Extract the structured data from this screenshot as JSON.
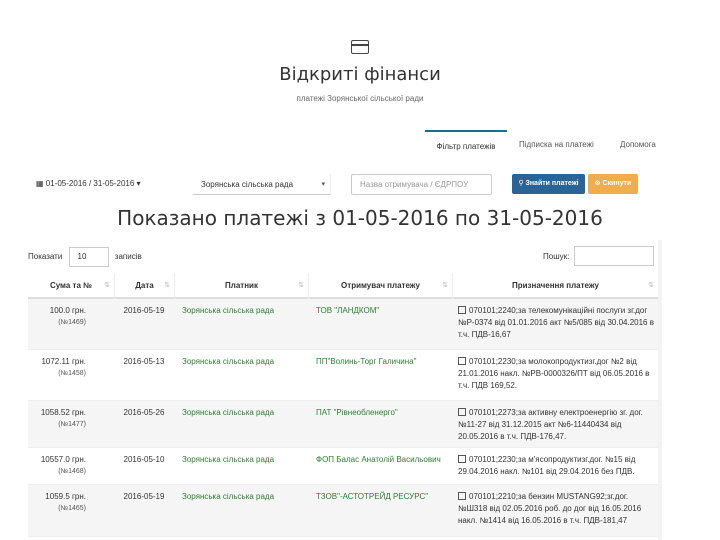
{
  "brand": {
    "icon": "credit-card-icon",
    "title": "Відкриті фінанси",
    "subtitle": "платежі Зорянської сільської ради"
  },
  "tabs": [
    {
      "label": "Фільтр платежів",
      "active": true
    },
    {
      "label": "Підписка на платежі",
      "active": false
    },
    {
      "label": "Допомога",
      "active": false
    }
  ],
  "toolbar": {
    "date_range": "01-05-2016 / 31-05-2016",
    "payer_value": "Зорянська сільська рада",
    "search_placeholder": "Назва отримувача / ЄДРПОУ",
    "find_label": "Знайти платежі",
    "reset_label": "Скинути",
    "accent_primary": "#2a6496",
    "accent_warning": "#f0ad4e"
  },
  "heading": "Показано платежі з 01-05-2016 по 31-05-2016",
  "length": {
    "prefix": "Показати",
    "value": "10",
    "suffix": "записів"
  },
  "filter": {
    "label": "Пошук:"
  },
  "table": {
    "columns": [
      "Сума та №",
      "Дата",
      "Платник",
      "Отримувач платежу",
      "Призначення платежу"
    ],
    "rows": [
      {
        "amount": "100.0 грн.",
        "number": "(№1469)",
        "date": "2016-05-19",
        "payer": "Зорянська сільська рада",
        "recipient": "ТОВ \"ЛАНДКОМ\"",
        "purpose": "070101;2240;за телекомунікаційні послуги зг.дог №Р-0374 від 01.01.2016 акт №5/085 від 30.04.2016 в т.ч. ПДВ-16,67"
      },
      {
        "amount": "1072.11 грн.",
        "number": "(№1458)",
        "date": "2016-05-13",
        "payer": "Зорянська сільська рада",
        "recipient": "ПП\"Волинь-Торг Галичина\"",
        "purpose": "070101;2230;за молокопродуктизг.дог №2 від 21.01.2016 накл. №РВ-0000326/ПТ від 06.05.2016 в т.ч. ПДВ 169,52."
      },
      {
        "amount": "1058.52 грн.",
        "number": "(№1477)",
        "date": "2016-05-26",
        "payer": "Зорянська сільська рада",
        "recipient": "ПАТ \"Рівнеобленерго\"",
        "purpose": "070101;2273;за активну електроенергію зг. дог. №11-27 від 31.12.2015 акт №6-11440434 від 20.05.2016 в т.ч. ПДВ-176,47."
      },
      {
        "amount": "10557.0 грн.",
        "number": "(№1468)",
        "date": "2016-05-10",
        "payer": "Зорянська сільська рада",
        "recipient": "ФОП Балас Анатолій Васильович",
        "purpose": "070101;2230;за м'ясопродуктизг.дог. №15 від 29.04.2016 накл. №101 від 29.04.2016 без ПДВ."
      },
      {
        "amount": "1059.5 грн.",
        "number": "(№1465)",
        "date": "2016-05-19",
        "payer": "Зорянська сільська рада",
        "recipient": "ТЗОВ\"-АСТОТРЕЙД РЕСУРС\"",
        "purpose": "070101;2210;за бензин MUSTANG92;зг.дог. №Ш318 від 02.05.2016 роб. до дог від 16.05.2016 накл. №1414 від 16.05.2016 в т.ч. ПДВ-181,47"
      }
    ]
  }
}
